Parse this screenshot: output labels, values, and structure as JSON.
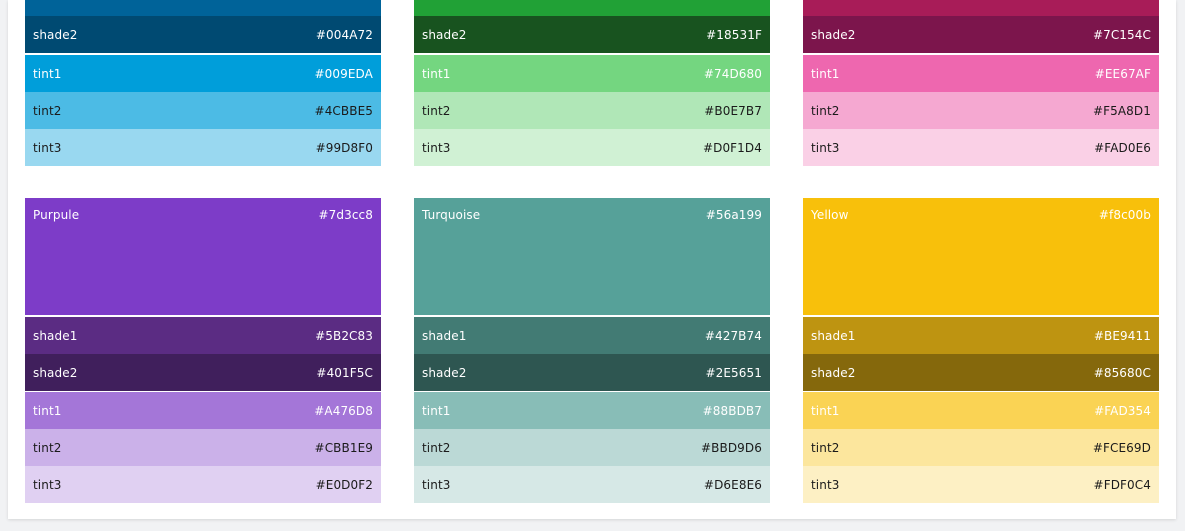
{
  "palettes": [
    {
      "id": "blue",
      "cap_color": "#006399",
      "rows": [
        {
          "label": "shade2",
          "value": "#004A72",
          "bg": "#004A72",
          "fg": "#ffffff"
        },
        {
          "label": "tint1",
          "value": "#009EDA",
          "bg": "#009EDA",
          "fg": "#ffffff"
        },
        {
          "label": "tint2",
          "value": "#4CBBE5",
          "bg": "#4CBBE5",
          "fg": "#1a1a1a"
        },
        {
          "label": "tint3",
          "value": "#99D8F0",
          "bg": "#99D8F0",
          "fg": "#1a1a1a"
        }
      ]
    },
    {
      "id": "green",
      "cap_color": "#21a136",
      "rows": [
        {
          "label": "shade2",
          "value": "#18531F",
          "bg": "#18531F",
          "fg": "#ffffff"
        },
        {
          "label": "tint1",
          "value": "#74D680",
          "bg": "#74D680",
          "fg": "#ffffff"
        },
        {
          "label": "tint2",
          "value": "#B0E7B7",
          "bg": "#B0E7B7",
          "fg": "#1a1a1a"
        },
        {
          "label": "tint3",
          "value": "#D0F1D4",
          "bg": "#D0F1D4",
          "fg": "#1a1a1a"
        }
      ]
    },
    {
      "id": "pink",
      "cap_color": "#a81c58",
      "rows": [
        {
          "label": "shade2",
          "value": "#7C154C",
          "bg": "#7C154C",
          "fg": "#ffffff"
        },
        {
          "label": "tint1",
          "value": "#EE67AF",
          "bg": "#EE67AF",
          "fg": "#ffffff"
        },
        {
          "label": "tint2",
          "value": "#F5A8D1",
          "bg": "#F5A8D1",
          "fg": "#1a1a1a"
        },
        {
          "label": "tint3",
          "value": "#FAD0E6",
          "bg": "#FAD0E6",
          "fg": "#1a1a1a"
        }
      ]
    },
    {
      "id": "purple",
      "rows": [
        {
          "label": "Purpule",
          "value": "#7d3cc8",
          "bg": "#7d3cc8",
          "fg": "#ffffff",
          "main": true
        },
        {
          "label": "shade1",
          "value": "#5B2C83",
          "bg": "#5B2C83",
          "fg": "#ffffff"
        },
        {
          "label": "shade2",
          "value": "#401F5C",
          "bg": "#401F5C",
          "fg": "#ffffff"
        },
        {
          "label": "tint1",
          "value": "#A476D8",
          "bg": "#A476D8",
          "fg": "#ffffff"
        },
        {
          "label": "tint2",
          "value": "#CBB1E9",
          "bg": "#CBB1E9",
          "fg": "#1a1a1a"
        },
        {
          "label": "tint3",
          "value": "#E0D0F2",
          "bg": "#E0D0F2",
          "fg": "#1a1a1a"
        }
      ]
    },
    {
      "id": "turquoise",
      "rows": [
        {
          "label": "Turquoise",
          "value": "#56a199",
          "bg": "#56a199",
          "fg": "#ffffff",
          "main": true
        },
        {
          "label": "shade1",
          "value": "#427B74",
          "bg": "#427B74",
          "fg": "#ffffff"
        },
        {
          "label": "shade2",
          "value": "#2E5651",
          "bg": "#2E5651",
          "fg": "#ffffff"
        },
        {
          "label": "tint1",
          "value": "#88BDB7",
          "bg": "#88BDB7",
          "fg": "#ffffff"
        },
        {
          "label": "tint2",
          "value": "#BBD9D6",
          "bg": "#BBD9D6",
          "fg": "#1a1a1a"
        },
        {
          "label": "tint3",
          "value": "#D6E8E6",
          "bg": "#D6E8E6",
          "fg": "#1a1a1a"
        }
      ]
    },
    {
      "id": "yellow",
      "rows": [
        {
          "label": "Yellow",
          "value": "#f8c00b",
          "bg": "#f8c00b",
          "fg": "#ffffff",
          "main": true
        },
        {
          "label": "shade1",
          "value": "#BE9411",
          "bg": "#BE9411",
          "fg": "#ffffff"
        },
        {
          "label": "shade2",
          "value": "#85680C",
          "bg": "#85680C",
          "fg": "#ffffff"
        },
        {
          "label": "tint1",
          "value": "#FAD354",
          "bg": "#FAD354",
          "fg": "#ffffff"
        },
        {
          "label": "tint2",
          "value": "#FCE69D",
          "bg": "#FCE69D",
          "fg": "#1a1a1a"
        },
        {
          "label": "tint3",
          "value": "#FDF0C4",
          "bg": "#FDF0C4",
          "fg": "#1a1a1a"
        }
      ]
    }
  ]
}
